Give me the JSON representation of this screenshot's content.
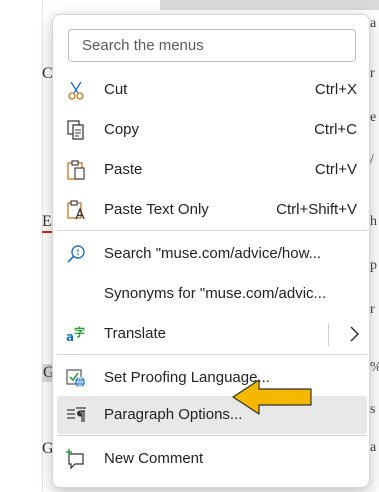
{
  "background": {
    "left_letters": [
      "C",
      "E",
      "G",
      "G"
    ],
    "right_letters": [
      "a",
      "r",
      "e",
      "/",
      "h",
      "p",
      "r",
      "%",
      "s",
      "a"
    ]
  },
  "menu": {
    "search_placeholder": "Search the menus",
    "items": [
      {
        "label": "Cut",
        "shortcut": "Ctrl+X",
        "icon": "scissors-icon"
      },
      {
        "label": "Copy",
        "shortcut": "Ctrl+C",
        "icon": "copy-icon"
      },
      {
        "label": "Paste",
        "shortcut": "Ctrl+V",
        "icon": "paste-icon"
      },
      {
        "label": "Paste Text Only",
        "shortcut": "Ctrl+Shift+V",
        "icon": "paste-text-only-icon"
      },
      {
        "label": "Search \"muse.com/advice/how...",
        "icon": "search-icon"
      },
      {
        "label": "Synonyms for \"muse.com/advic..."
      },
      {
        "label": "Translate",
        "icon": "translate-icon",
        "submenu": true
      },
      {
        "label": "Set Proofing Language...",
        "icon": "proofing-language-icon"
      },
      {
        "label": "Paragraph Options...",
        "icon": "paragraph-options-icon"
      },
      {
        "label": "New Comment",
        "icon": "new-comment-icon"
      }
    ]
  },
  "colors": {
    "accent_blue": "#1a73c8",
    "paste_orange": "#c8761e",
    "annotation_arrow": "#f5b800",
    "hover_bg": "#e8e8e8"
  }
}
